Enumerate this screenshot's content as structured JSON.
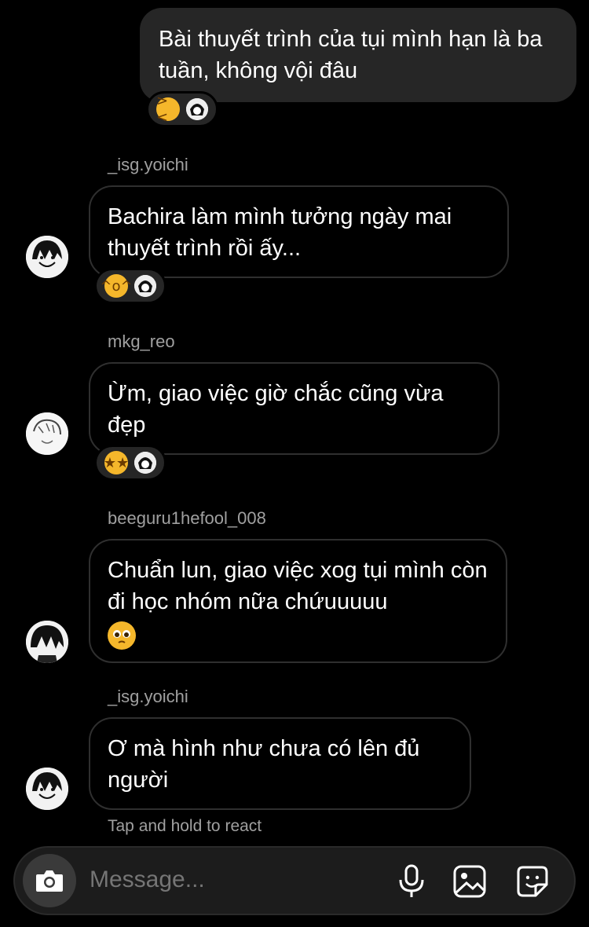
{
  "messages": [
    {
      "text": "Bài thuyết trình của tụi mình hạn là ba tuần, không vội đâu"
    },
    {
      "sender": "_isg.yoichi",
      "text": "Bachira làm mình tưởng ngày mai thuyết trình rồi ấy..."
    },
    {
      "sender": "mkg_reo",
      "text": "Ừm, giao việc giờ chắc cũng vừa đẹp"
    },
    {
      "sender": "beeguru1hefool_008",
      "text": "Chuẩn lun, giao việc xog tụi mình còn đi học nhóm nữa chứuuuuu"
    },
    {
      "sender": "_isg.yoichi",
      "text": "Ơ mà hình như chưa có lên đủ người"
    }
  ],
  "reactions": [
    {
      "emoji": "weary-face"
    },
    {
      "emoji": "tears-of-joy-face"
    },
    {
      "emoji": "star-struck-face"
    }
  ],
  "inline_emoji": "pleading-face",
  "hint": "Tap and hold to react",
  "composer": {
    "placeholder": "Message...",
    "icons": [
      "camera-icon",
      "microphone-icon",
      "gallery-icon",
      "sticker-icon"
    ]
  },
  "colors": {
    "background": "#000000",
    "outgoing_bubble": "#262626",
    "emoji_yellow": "#f5b72b"
  }
}
